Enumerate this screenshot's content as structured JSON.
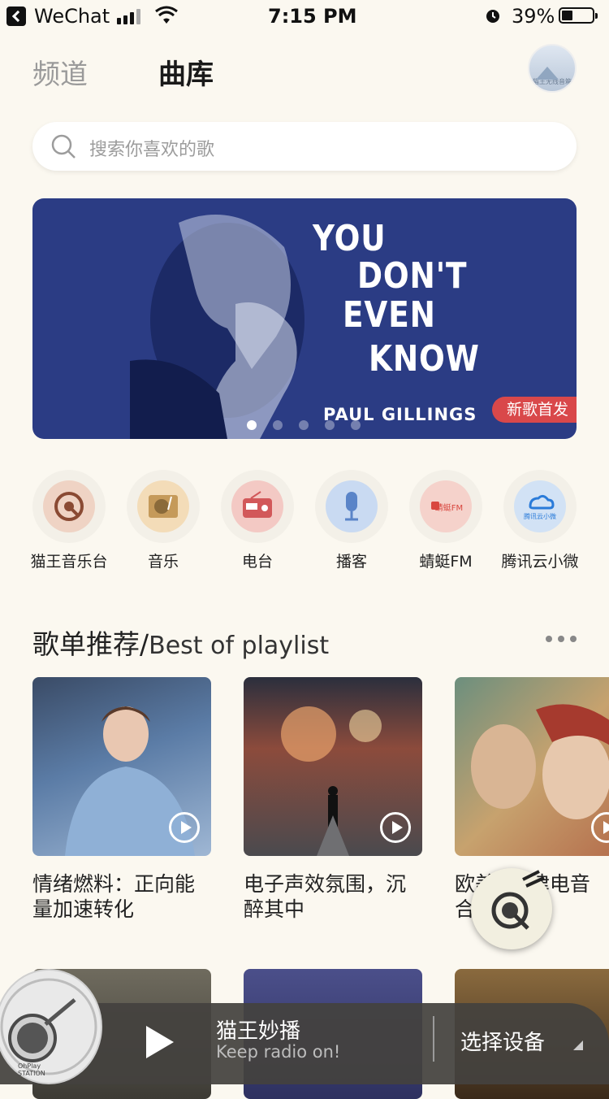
{
  "status": {
    "carrier": "WeChat",
    "time": "7:15 PM",
    "battery": "39%"
  },
  "header": {
    "tab_channel": "频道",
    "tab_library": "曲库",
    "avatar_label": "猫王无线音箱"
  },
  "search": {
    "placeholder": "搜索你喜欢的歌"
  },
  "banner": {
    "lines": [
      "YOU",
      "DON'T",
      "EVEN",
      "KNOW"
    ],
    "artist": "PAUL GILLINGS",
    "tag": "新歌首发",
    "dot_count": 5,
    "active_dot": 0
  },
  "channels": [
    {
      "label": "猫王音乐台",
      "icon": "radio-dial-icon",
      "color": "#efd3c4"
    },
    {
      "label": "音乐",
      "icon": "turntable-icon",
      "color": "#f3dcb8"
    },
    {
      "label": "电台",
      "icon": "radio-icon",
      "color": "#f3c9c4"
    },
    {
      "label": "播客",
      "icon": "microphone-icon",
      "color": "#c9daf2"
    },
    {
      "label": "蜻蜓FM",
      "icon": "qingting-fm-icon",
      "color": "#f5d2cb",
      "icon_text": "蜻蜓FM"
    },
    {
      "label": "腾讯云小微",
      "icon": "tencent-cloud-icon",
      "color": "#d2e2f5",
      "icon_text": "腾讯云小微"
    }
  ],
  "section": {
    "title_cn": "歌单推荐/",
    "title_en": "Best of playlist"
  },
  "playlists": [
    {
      "title": "情绪燃料：正向能量加速转化"
    },
    {
      "title": "电子声效氛围，沉醉其中"
    },
    {
      "title": "欧美//旋律电音合"
    }
  ],
  "player": {
    "title": "猫王妙播",
    "subtitle": "Keep radio on!",
    "device": "选择设备",
    "disc_label": "OhPlay STATION"
  }
}
